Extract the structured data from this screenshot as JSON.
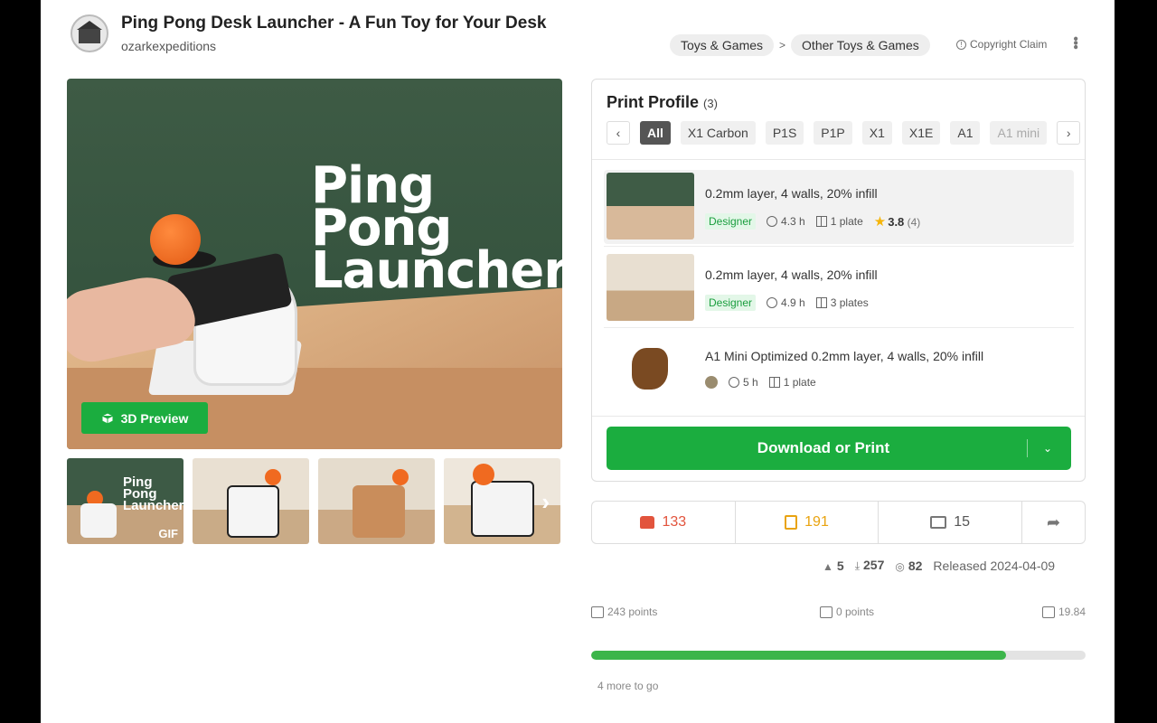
{
  "header": {
    "title": "Ping Pong Desk Launcher - A Fun Toy for Your Desk",
    "author": "ozarkexpeditions",
    "breadcrumbs": [
      "Toys & Games",
      "Other Toys & Games"
    ],
    "breadcrumb_separator": ">",
    "copyright_label": "Copyright Claim"
  },
  "hero": {
    "overlay_text_line1": "Ping",
    "overlay_text_line2": "Pong",
    "overlay_text_line3": "Launcher",
    "preview_label": "3D Preview"
  },
  "thumbnails": {
    "first_text": "Ping Pong Launcher",
    "first_badge": "GIF"
  },
  "print_profile": {
    "title": "Print Profile",
    "count": "(3)",
    "filters": [
      "All",
      "X1 Carbon",
      "P1S",
      "P1P",
      "X1",
      "X1E",
      "A1",
      "A1 mini"
    ],
    "active_filter": "All",
    "profiles": [
      {
        "name": "0.2mm layer, 4 walls, 20% infill",
        "badge": "Designer",
        "time": "4.3 h",
        "plates": "1 plate",
        "rating": "3.8",
        "rating_count": "(4)"
      },
      {
        "name": "0.2mm layer, 4 walls, 20% infill",
        "badge": "Designer",
        "time": "4.9 h",
        "plates": "3 plates"
      },
      {
        "name": "A1 Mini Optimized 0.2mm layer, 4 walls, 20% infill",
        "time": "5 h",
        "plates": "1 plate"
      }
    ],
    "download_label": "Download or Print"
  },
  "stats": {
    "likes": "133",
    "collects": "191",
    "comments": "15"
  },
  "meta": {
    "boosts": "5",
    "downloads": "257",
    "prints": "82",
    "released": "Released 2024-04-09"
  },
  "points": {
    "download_points": "243 points",
    "boost_points": "0 points",
    "cash": "19.84",
    "progress_percent": 84,
    "remaining": "4 more to go"
  },
  "colors": {
    "accent_green": "#1bad3f",
    "like_red": "#e2543d",
    "collect_yellow": "#e9a30f"
  }
}
